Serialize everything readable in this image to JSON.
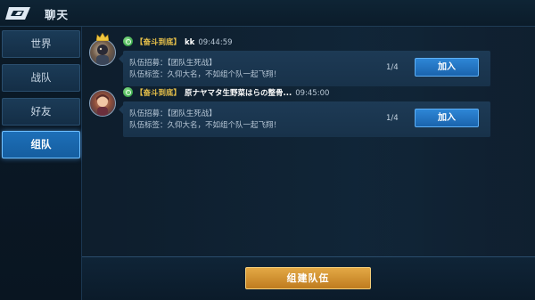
{
  "header": {
    "title": "聊天"
  },
  "sidebar": {
    "items": [
      {
        "label": "世界",
        "active": false
      },
      {
        "label": "战队",
        "active": false
      },
      {
        "label": "好友",
        "active": false
      },
      {
        "label": "组队",
        "active": true
      }
    ]
  },
  "messages": [
    {
      "guild_tag": "【奋斗到底】",
      "player_name": "kk",
      "time": "09:44:59",
      "has_crown": true,
      "recruit_text": "队伍招募：【团队生死战】",
      "tag_text": "队伍标签：久仰大名，不如组个队一起飞翔！",
      "count": "1/4",
      "join_label": "加入"
    },
    {
      "guild_tag": "【奋斗到底】",
      "player_name": "原ナヤマタ生野菜はらの整骨...",
      "time": "09:45:00",
      "has_crown": false,
      "recruit_text": "队伍招募：【团队生死战】",
      "tag_text": "队伍标签：久仰大名，不如组个队一起飞翔！",
      "count": "1/4",
      "join_label": "加入"
    }
  ],
  "footer": {
    "create_team_label": "组建队伍"
  },
  "colors": {
    "guild_tag": "#e9c24a",
    "active_tab": "#1d6fb8",
    "join_button": "#2e86d6",
    "create_button": "#e3a845"
  },
  "icons": {
    "back": "back-arrow-icon",
    "crown": "crown-icon",
    "badge": "guild-badge-icon"
  }
}
